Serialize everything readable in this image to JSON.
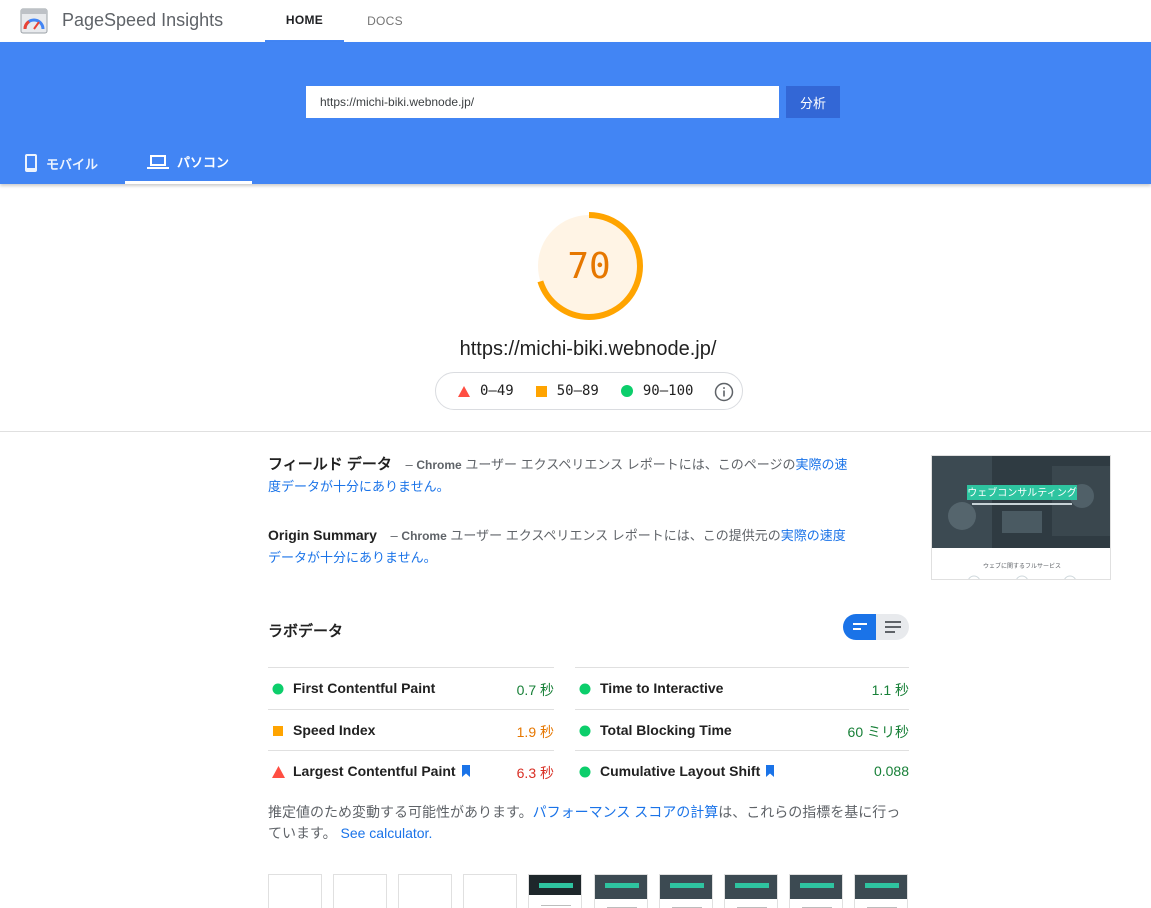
{
  "app": {
    "title": "PageSpeed Insights",
    "nav": [
      {
        "label": "HOME",
        "active": true
      },
      {
        "label": "DOCS",
        "active": false
      }
    ]
  },
  "search": {
    "url_value": "https://michi-biki.webnode.jp/",
    "analyze_label": "分析"
  },
  "devices": [
    {
      "label": "モバイル",
      "icon": "smartphone-icon",
      "active": false
    },
    {
      "label": "パソコン",
      "icon": "laptop-icon",
      "active": true
    }
  ],
  "score": {
    "value": 70,
    "fraction": 0.7,
    "color": "#ffa400",
    "text_color": "#e67700",
    "tested_url": "https://michi-biki.webnode.jp/"
  },
  "legend": [
    {
      "range": "0–49",
      "icon": "triangle-icon",
      "color": "#ff4e42"
    },
    {
      "range": "50–89",
      "icon": "square-icon",
      "color": "#ffa400"
    },
    {
      "range": "90–100",
      "icon": "circle-icon",
      "color": "#0cce6b"
    }
  ],
  "field_data": {
    "title": "フィールド データ",
    "dash": "–",
    "chrome": "Chrome",
    "text": " ユーザー エクスペリエンス レポートには、このページの",
    "link": "実際の速度データが十分にありません。"
  },
  "origin_summary": {
    "title": "Origin Summary",
    "dash": "–",
    "chrome": "Chrome",
    "text": " ユーザー エクスペリエンス レポートには、この提供元の",
    "link": "実際の速度データが十分にありません。"
  },
  "screenshot_thumb": {
    "headline": "ウェブコンサルティング",
    "subline": "ウェブに関するフルサービス"
  },
  "lab_data": {
    "title": "ラボデータ",
    "metrics_left": [
      {
        "name": "First Contentful Paint",
        "value": "0.7 秒",
        "status": "pass",
        "bookmark": false
      },
      {
        "name": "Speed Index",
        "value": "1.9 秒",
        "status": "avg",
        "bookmark": false
      },
      {
        "name": "Largest Contentful Paint",
        "value": "6.3 秒",
        "status": "fail",
        "bookmark": true
      }
    ],
    "metrics_right": [
      {
        "name": "Time to Interactive",
        "value": "1.1 秒",
        "status": "pass",
        "bookmark": false
      },
      {
        "name": "Total Blocking Time",
        "value": "60 ミリ秒",
        "status": "pass",
        "bookmark": false
      },
      {
        "name": "Cumulative Layout Shift",
        "value": "0.088",
        "status": "pass",
        "bookmark": true
      }
    ]
  },
  "note": {
    "text1": "推定値のため変動する可能性があります。",
    "link1": "パフォーマンス スコアの計算",
    "text2": "は、これらの指標を基に行っています。",
    "link2": "See calculator."
  },
  "colors": {
    "brand_blue": "#4285f4",
    "link": "#1a73e8",
    "pass": "#0cce6b",
    "average": "#ffa400",
    "fail": "#ff4e42"
  }
}
